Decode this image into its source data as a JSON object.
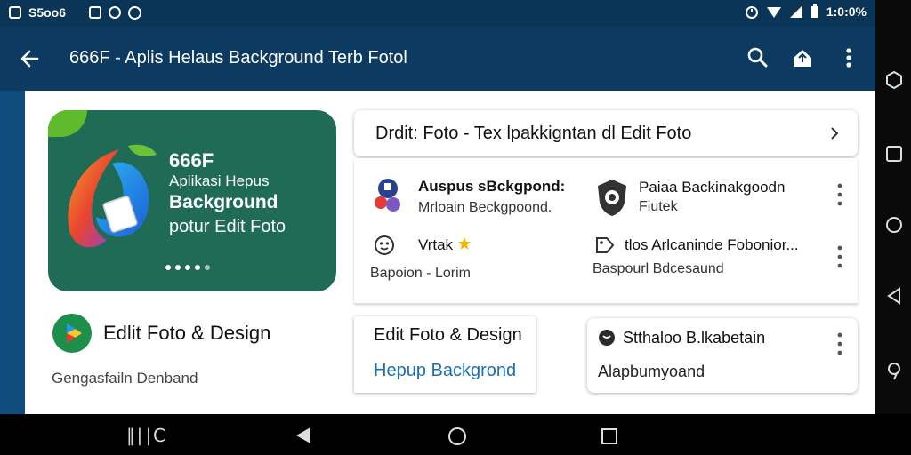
{
  "status_bar": {
    "left_text": "S5oo6",
    "time": "1:0:0%",
    "icons_left": [
      "notification-box-icon",
      "message-icon",
      "whatsapp-icon",
      "settings-circle-icon"
    ],
    "icons_right": [
      "alarm-icon",
      "wifi-icon",
      "signal-icon",
      "battery-icon"
    ]
  },
  "app_bar": {
    "title": "666F - Aplis Helaus Background Terb Fotol",
    "actions": [
      "search-icon",
      "share-icon",
      "more-vert-icon"
    ]
  },
  "hero": {
    "line1": "666F",
    "line2": "Aplikasi Hepus",
    "line3": "Background",
    "line4": "potur Edit Foto",
    "page_dots": 5
  },
  "app_listing": {
    "title": "Edlit Foto & Design",
    "subtitle": "Gengasfailn Denband"
  },
  "search_card": {
    "text": "Drdit: Foto -  Tex lpakkigntan dl Edit Foto"
  },
  "items": [
    {
      "title": "Auspus sBckgpond:",
      "subtitle": "Mrloain Beckgpoond."
    },
    {
      "title": "Paiaa Backinakgoodn",
      "subtitle": "Fiutek"
    },
    {
      "title": "Vrtak",
      "subtitle": "Bapoion - Lorim"
    },
    {
      "title": "tlos Arlcaninde Fobonior...",
      "subtitle": "Baspourl Bdcesaund"
    }
  ],
  "card2": {
    "title": "Edit Foto & Design",
    "link": "Hepup Backgrond"
  },
  "card3": {
    "title": "Stthaloo B.lkabetain",
    "subtitle": "Alapbumyoand"
  },
  "nav_bar": {
    "recents_label": "∥∣∣C"
  },
  "colors": {
    "status_bar": "#0b3557",
    "app_bar": "#0c3a61",
    "hero_bg": "#1f6b55",
    "link": "#1a6fb5",
    "accent_green": "#5fbb2b"
  }
}
